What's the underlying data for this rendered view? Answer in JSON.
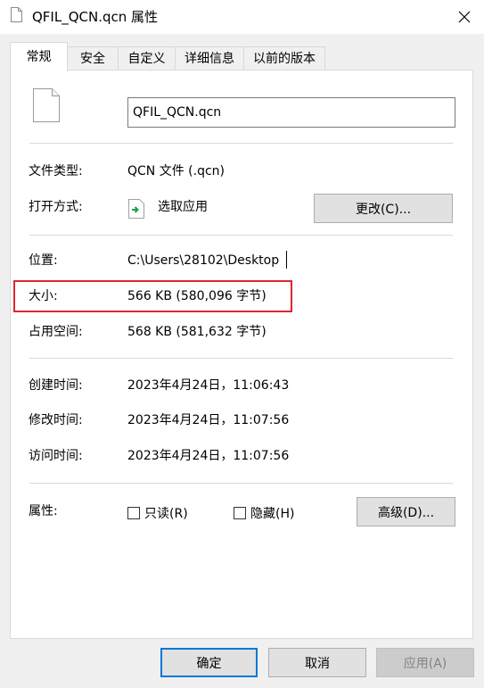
{
  "window": {
    "title": "QFIL_QCN.qcn 属性",
    "close_icon": "close-icon"
  },
  "tabs": [
    {
      "label": "常规",
      "active": true
    },
    {
      "label": "安全",
      "active": false
    },
    {
      "label": "自定义",
      "active": false
    },
    {
      "label": "详细信息",
      "active": false
    },
    {
      "label": "以前的版本",
      "active": false
    }
  ],
  "general": {
    "file_name": "QFIL_QCN.qcn",
    "file_type": {
      "label": "文件类型:",
      "value": "QCN 文件 (.qcn)"
    },
    "open_with": {
      "label": "打开方式:",
      "value": "选取应用",
      "button": "更改(C)..."
    },
    "location": {
      "label": "位置:",
      "value": "C:\\Users\\28102\\Desktop"
    },
    "size": {
      "label": "大小:",
      "value": "566 KB (580,096 字节)"
    },
    "size_on_disk": {
      "label": "占用空间:",
      "value": "568 KB (581,632 字节)"
    },
    "created": {
      "label": "创建时间:",
      "value": "2023年4月24日，11:06:43"
    },
    "modified": {
      "label": "修改时间:",
      "value": "2023年4月24日，11:07:56"
    },
    "accessed": {
      "label": "访问时间:",
      "value": "2023年4月24日，11:07:56"
    },
    "attributes": {
      "label": "属性:",
      "readonly": {
        "label": "只读(R)",
        "checked": false
      },
      "hidden": {
        "label": "隐藏(H)",
        "checked": false
      },
      "advanced_button": "高级(D)..."
    }
  },
  "footer": {
    "ok": "确定",
    "cancel": "取消",
    "apply": "应用(A)"
  },
  "colors": {
    "highlight_box": "#e0242f",
    "default_button_border": "#0078d7"
  }
}
